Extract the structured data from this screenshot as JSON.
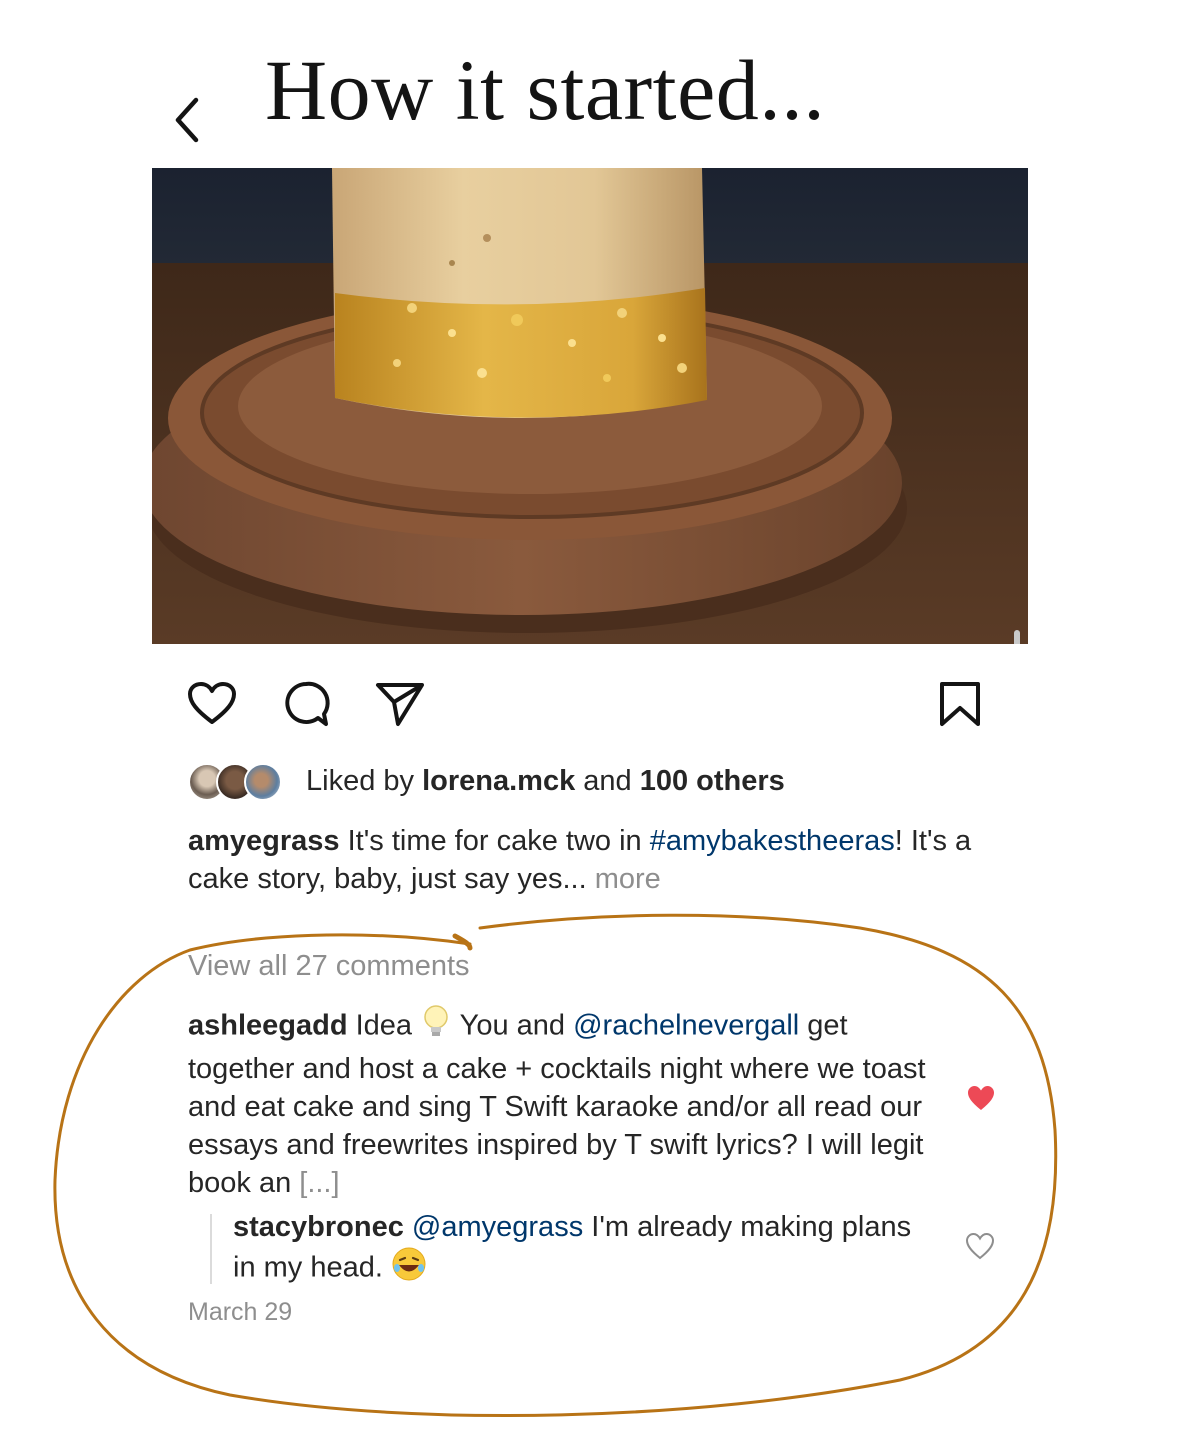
{
  "story": {
    "title": "How it started...",
    "back_icon": "chevron-left-icon"
  },
  "post": {
    "photo": "golden-cake-on-wooden-board",
    "actions": {
      "like_icon": "heart-outline-icon",
      "comment_icon": "comment-bubble-icon",
      "share_icon": "paper-plane-icon",
      "save_icon": "bookmark-icon"
    },
    "likes": {
      "prefix": "Liked by ",
      "user": "lorena.mck",
      "middle": " and ",
      "others": "100 others"
    },
    "caption": {
      "username": "amyegrass",
      "text_1": " It's time for cake two in ",
      "hashtag": "#amybakestheeras",
      "text_2": "! It's a cake story, baby, just say yes...",
      "more": " more"
    },
    "view_all_comments": "View all 27 comments",
    "comment": {
      "username": "ashleegadd",
      "text_1": " Idea ",
      "text_2": " You and ",
      "mention": "@rachelnevergall",
      "text_3": " get together and host a cake + cocktails night where we toast and eat cake and sing T Swift karaoke and/or all read our essays and freewrites inspired by T swift lyrics? I will legit book an ",
      "ellipsis": "[...]",
      "liked": true
    },
    "reply": {
      "username": "stacybronec",
      "mention": "@amyegrass",
      "text": " I'm already making plans in my head. ",
      "liked": false
    },
    "date": "March 29"
  },
  "colors": {
    "annotation": "#b87316",
    "heart_red": "#ed4956",
    "link": "#00376b",
    "muted": "#8e8e8e"
  }
}
